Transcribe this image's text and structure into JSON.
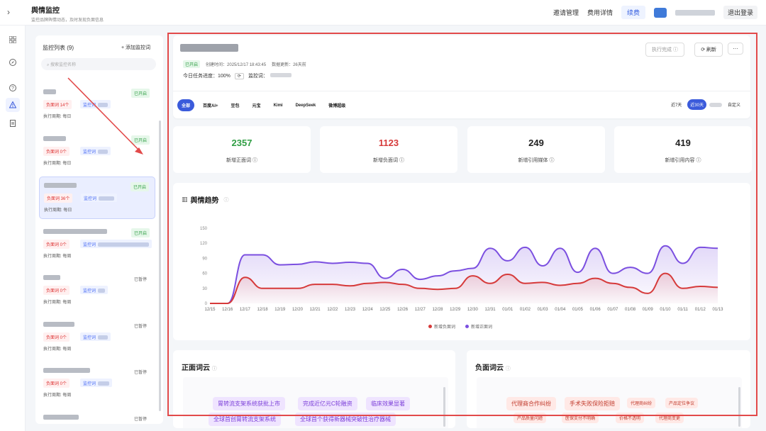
{
  "header": {
    "title": "舆情监控",
    "subtitle": "监控品牌舆情动态，及时发现负面信息",
    "nav": [
      "邀请管理",
      "费用详情"
    ],
    "renew": "续费",
    "logout": "退出登录",
    "expand_icon": "›"
  },
  "rail": {
    "icons": [
      "grid-icon",
      "compass-icon",
      "help-icon",
      "alert-icon",
      "document-icon"
    ]
  },
  "monitor_list": {
    "header": "监控列表 (9)",
    "add_label": "+ 添加监控词",
    "search_placeholder": "搜索监控名称",
    "items": [
      {
        "status": "已开启",
        "negative": "负面词 14个",
        "keyword": "监控词",
        "period": "执行周期: 每日",
        "active": true,
        "selected": false
      },
      {
        "status": "已开启",
        "negative": "负面词 0个",
        "keyword": "监控词",
        "period": "执行周期: 每日",
        "active": true,
        "selected": false
      },
      {
        "status": "已开启",
        "negative": "负面词 36个",
        "keyword": "监控词",
        "period": "执行周期: 每日",
        "active": true,
        "selected": true
      },
      {
        "status": "已开启",
        "negative": "负面词 0个",
        "keyword": "监控词",
        "period": "执行周期: 每周",
        "active": true,
        "selected": false
      },
      {
        "status": "已暂停",
        "negative": "负面词 0个",
        "keyword": "监控词",
        "period": "执行周期: 每周",
        "active": false,
        "selected": false
      },
      {
        "status": "已暂停",
        "negative": "负面词 0个",
        "keyword": "监控词",
        "period": "执行周期: 每周",
        "active": false,
        "selected": false
      },
      {
        "status": "已暂停",
        "negative": "负面词 0个",
        "keyword": "监控词",
        "period": "执行周期: 每周",
        "active": false,
        "selected": false
      },
      {
        "status": "已暂停",
        "negative": "",
        "keyword": "",
        "period": "",
        "active": false,
        "selected": false
      }
    ]
  },
  "detail": {
    "status_badge": "已开启",
    "created": "创建时间：2025/12/17 18:43:45",
    "updated": "数据更新：26天前",
    "progress_label": "今日任务进度：",
    "progress_value": "100%",
    "keywords_label": "监控词：",
    "buttons": {
      "complete": "执行完成 ⓘ",
      "refresh": "⟳ 刷新",
      "more": "···"
    },
    "platforms": [
      "全部",
      "百度AI+",
      "豆包",
      "元宝",
      "Kimi",
      "DeepSeek",
      "微博超级"
    ],
    "active_platform": "全部",
    "ranges": [
      "近7天",
      "近30天",
      "",
      "自定义"
    ],
    "active_range": "近30天"
  },
  "stats": [
    {
      "value": "2357",
      "label": "新增正面词 ⓘ",
      "color": "#2f9e44"
    },
    {
      "value": "1123",
      "label": "新增负面词 ⓘ",
      "color": "#d63a3a"
    },
    {
      "value": "249",
      "label": "新增引用媒体 ⓘ",
      "color": "#222222"
    },
    {
      "value": "419",
      "label": "新增引用内容 ⓘ",
      "color": "#222222"
    }
  ],
  "trend": {
    "title": "舆情趋势",
    "icon": "bar-chart-icon",
    "info": "ⓘ"
  },
  "chart_data": {
    "type": "area",
    "title": "舆情趋势",
    "categories": [
      "12/15",
      "12/16",
      "12/17",
      "12/18",
      "12/19",
      "12/20",
      "12/21",
      "12/22",
      "12/23",
      "12/24",
      "12/25",
      "12/26",
      "12/27",
      "12/28",
      "12/29",
      "12/30",
      "12/31",
      "01/01",
      "01/02",
      "01/03",
      "01/04",
      "01/05",
      "01/06",
      "01/07",
      "01/08",
      "01/09",
      "01/10",
      "01/11",
      "01/12",
      "01/13"
    ],
    "yticks": [
      0,
      30,
      60,
      90,
      120,
      150
    ],
    "ylim": [
      0,
      150
    ],
    "series": [
      {
        "name": "新增负面词",
        "color": "#d63a3a",
        "values": [
          0,
          0,
          52,
          30,
          30,
          30,
          38,
          38,
          35,
          40,
          42,
          38,
          30,
          28,
          30,
          55,
          40,
          58,
          40,
          42,
          36,
          40,
          50,
          40,
          32,
          20,
          60,
          30,
          34,
          32
        ]
      },
      {
        "name": "新增正面词",
        "color": "#7b4fe0",
        "values": [
          0,
          0,
          97,
          97,
          77,
          78,
          83,
          80,
          82,
          80,
          50,
          68,
          48,
          55,
          65,
          70,
          110,
          85,
          112,
          75,
          110,
          62,
          110,
          60,
          72,
          60,
          115,
          80,
          112,
          110
        ]
      }
    ]
  },
  "clouds": {
    "positive": {
      "title": "正面词云",
      "info": "ⓘ",
      "tags": [
        "胃转流支架系统获批上市",
        "完成近亿元C轮融资",
        "临床效果显著",
        "全球首创胃转流支架系统",
        "全球首个获得新器械突破性治疗器械"
      ]
    },
    "negative": {
      "title": "负面词云",
      "info": "ⓘ",
      "tags": [
        "代理商合作纠纷",
        "手术失败保险拒赔",
        "代理商纠纷",
        "产品定位争议",
        "产品质量问题",
        "医保支付不明确",
        "价格不透明",
        "代理商变更"
      ]
    }
  }
}
